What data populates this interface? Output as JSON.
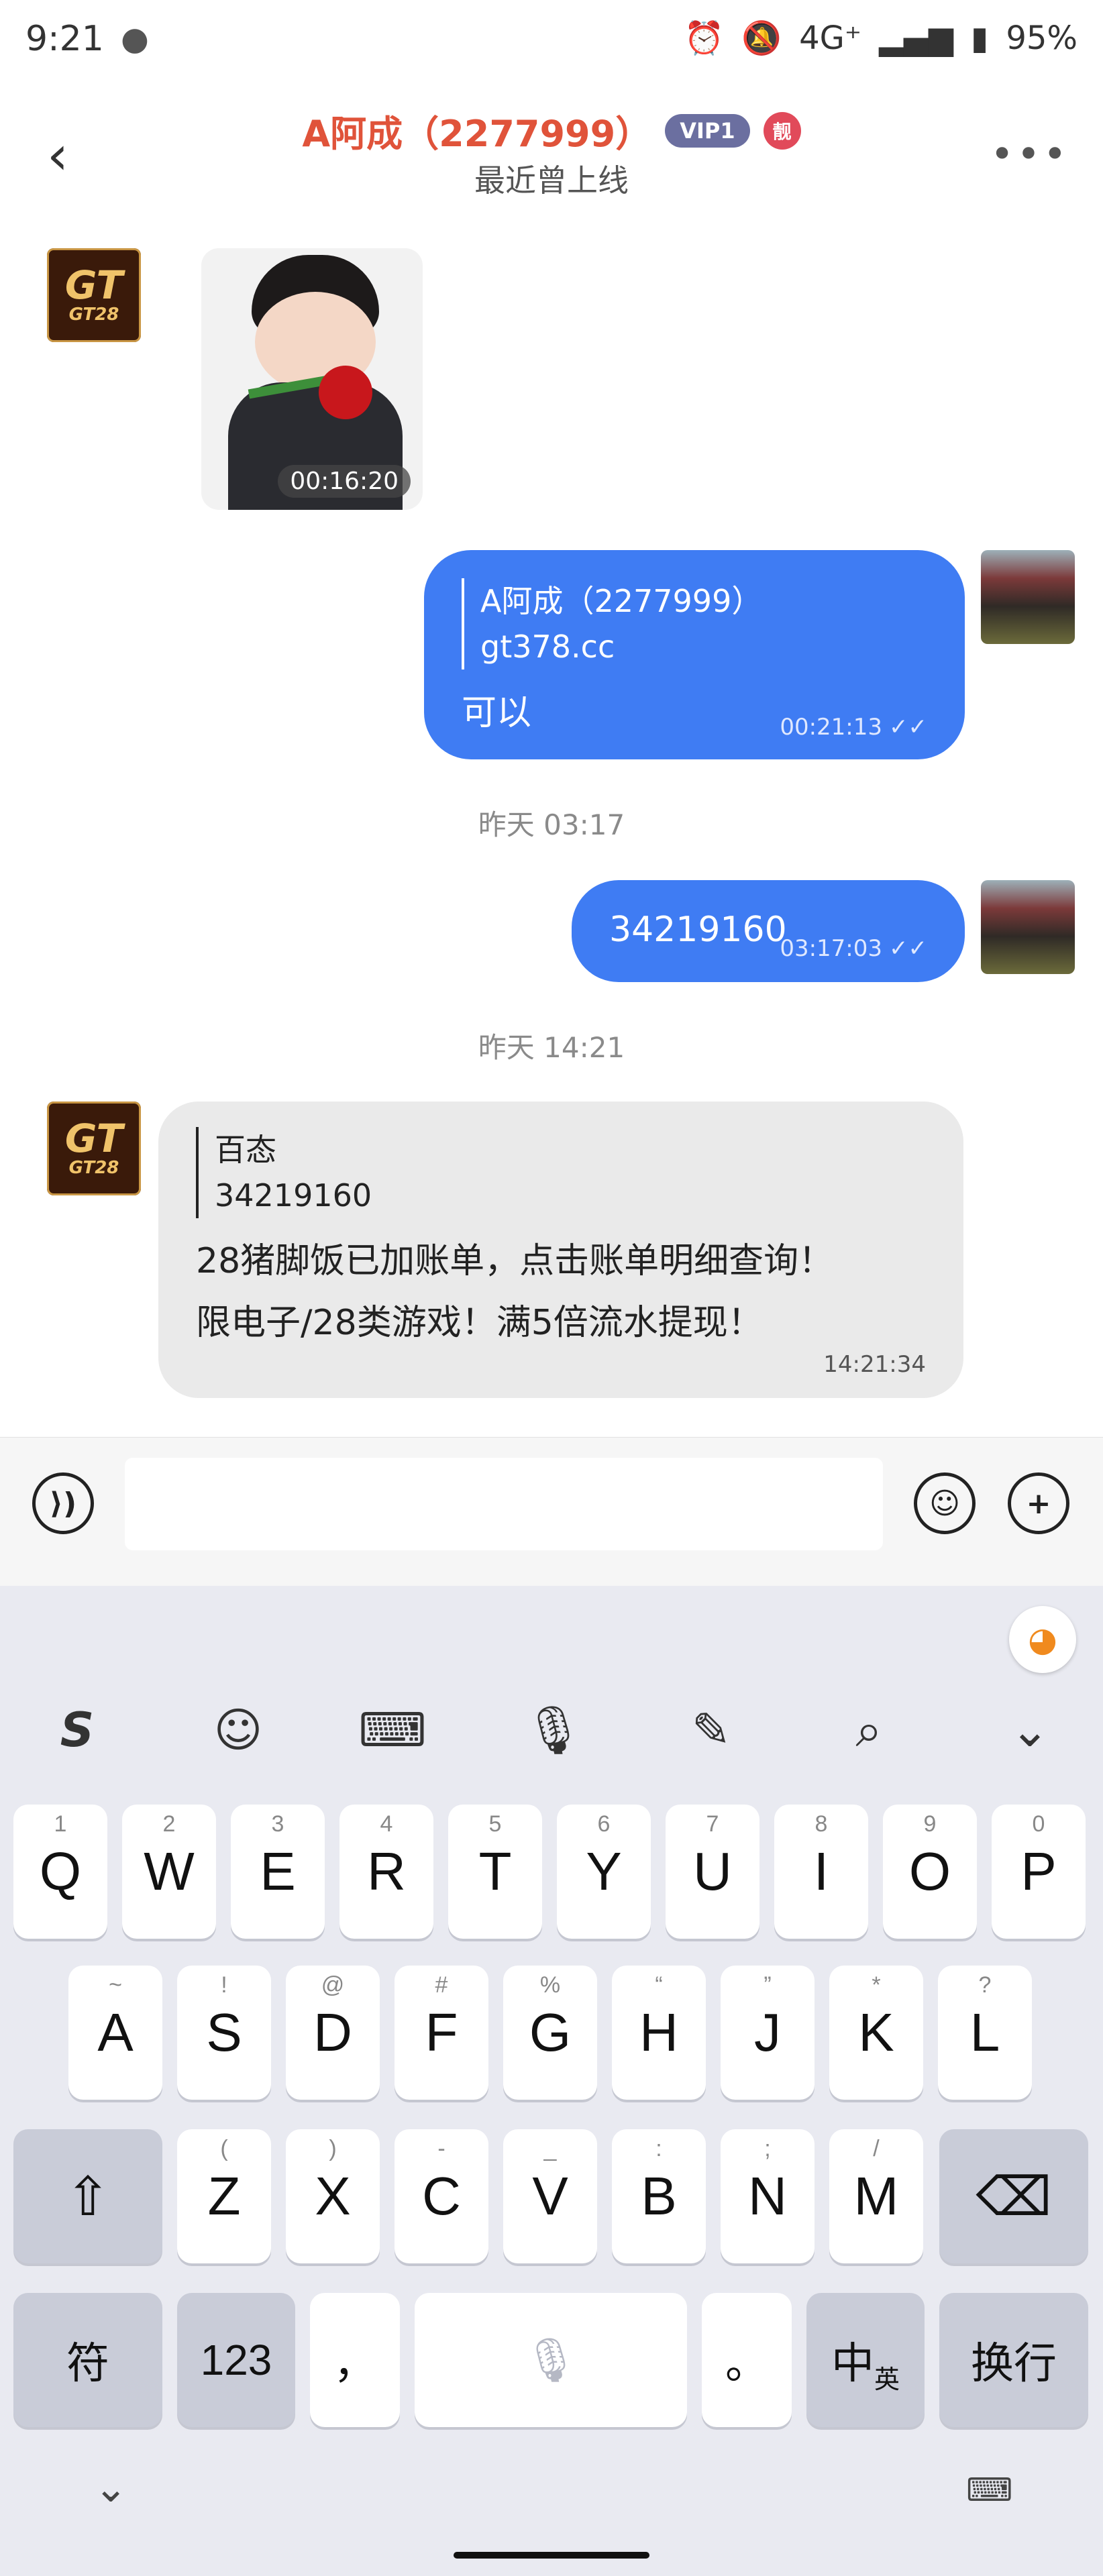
{
  "status": {
    "time": "9:21",
    "network": "4G⁺",
    "battery": "95%"
  },
  "header": {
    "name": "A阿成（2277999）",
    "vip": "VIP1",
    "badge": "靓",
    "subtitle": "最近曾上线"
  },
  "avatar": {
    "gt_line1": "GT",
    "gt_line2": "GT28"
  },
  "messages": {
    "sticker_time": "00:16:20",
    "msg1_quote_name": "A阿成（2277999）",
    "msg1_quote_text": "gt378.cc",
    "msg1_text": "可以",
    "msg1_time": "00:21:13",
    "ts1": "昨天 03:17",
    "msg2_text": "34219160",
    "msg2_time": "03:17:03",
    "ts2": "昨天 14:21",
    "msg3_quote_name": "百态",
    "msg3_quote_text": "34219160",
    "msg3_line1": "28猪脚饭已加账单，点击账单明细查询！",
    "msg3_line2": "限电子/28类游戏！满5倍流水提现！",
    "msg3_time": "14:21:34"
  },
  "keyboard": {
    "row1": [
      [
        "Q",
        "1"
      ],
      [
        "W",
        "2"
      ],
      [
        "E",
        "3"
      ],
      [
        "R",
        "4"
      ],
      [
        "T",
        "5"
      ],
      [
        "Y",
        "6"
      ],
      [
        "U",
        "7"
      ],
      [
        "I",
        "8"
      ],
      [
        "O",
        "9"
      ],
      [
        "P",
        "0"
      ]
    ],
    "row2": [
      [
        "A",
        "~"
      ],
      [
        "S",
        "!"
      ],
      [
        "D",
        "@"
      ],
      [
        "F",
        "#"
      ],
      [
        "G",
        "%"
      ],
      [
        "H",
        "“"
      ],
      [
        "J",
        "”"
      ],
      [
        "K",
        "*"
      ],
      [
        "L",
        "?"
      ]
    ],
    "row3": [
      [
        "Z",
        "("
      ],
      [
        "X",
        ")"
      ],
      [
        "C",
        "-"
      ],
      [
        "V",
        "_"
      ],
      [
        "B",
        ":"
      ],
      [
        "N",
        ";"
      ],
      [
        "M",
        "/"
      ]
    ],
    "fu": "符",
    "num": "123",
    "comma": "，",
    "period": "。",
    "zh": "中",
    "en": "英",
    "enter": "换行"
  }
}
